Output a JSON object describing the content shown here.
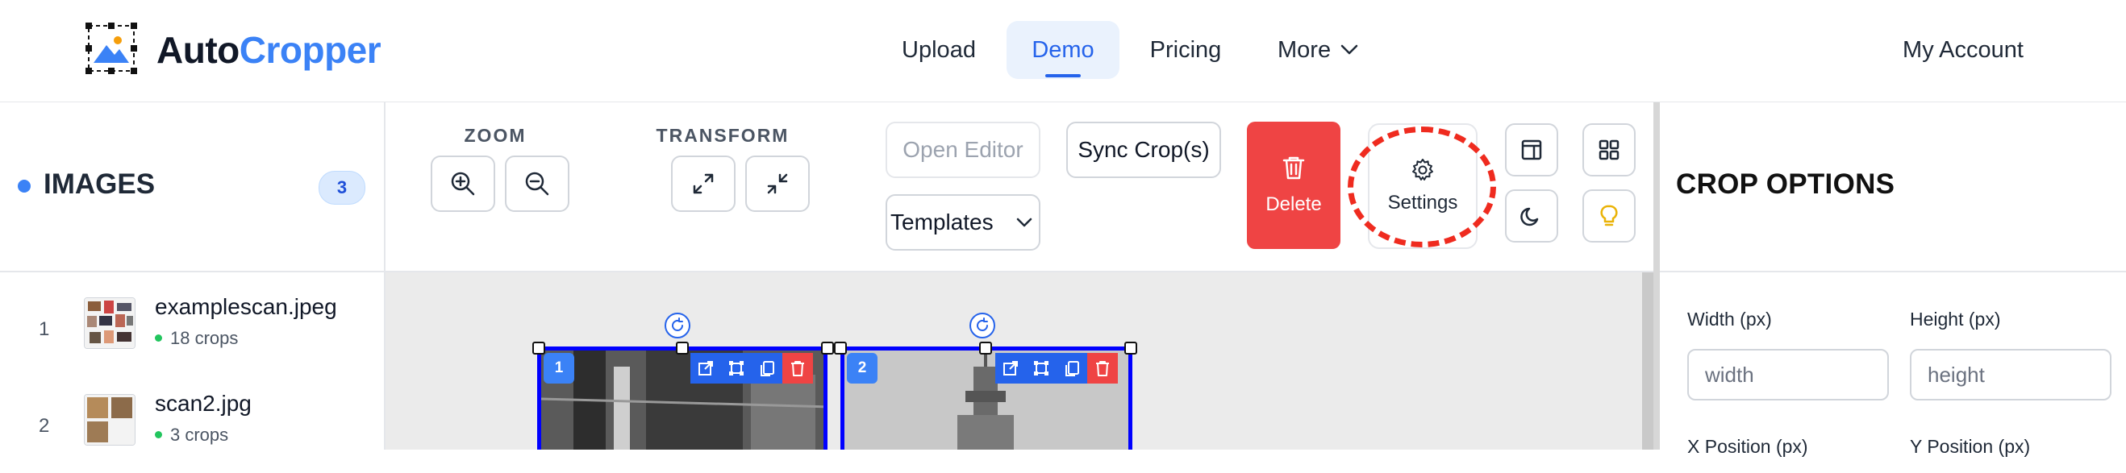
{
  "brand": {
    "name_part1": "Auto",
    "name_part2": "Cropper"
  },
  "nav": {
    "links": [
      "Upload",
      "Demo",
      "Pricing",
      "More"
    ],
    "account": "My Account"
  },
  "sidebar": {
    "title": "IMAGES",
    "count": "3",
    "images": [
      {
        "index": "1",
        "name": "examplescan.jpeg",
        "crops": "18 crops"
      },
      {
        "index": "2",
        "name": "scan2.jpg",
        "crops": "3 crops"
      }
    ]
  },
  "toolbar": {
    "zoom_label": "ZOOM",
    "transform_label": "TRANSFORM",
    "open_editor": "Open Editor",
    "sync_crops": "Sync Crop(s)",
    "templates": "Templates",
    "delete": "Delete",
    "settings": "Settings"
  },
  "canvas": {
    "crops": [
      {
        "number": "1"
      },
      {
        "number": "2"
      }
    ]
  },
  "crop_options": {
    "title": "CROP OPTIONS",
    "width_label": "Width (px)",
    "height_label": "Height (px)",
    "width_placeholder": "width",
    "height_placeholder": "height",
    "x_label": "X Position (px)",
    "y_label": "Y Position (px)"
  },
  "colors": {
    "brand_blue": "#3b82f6",
    "active_blue": "#2563eb",
    "delete_red": "#ef4444",
    "crop_border": "#0000ff",
    "highlight_ring": "#ef2b1f",
    "lightbulb": "#eab308"
  }
}
